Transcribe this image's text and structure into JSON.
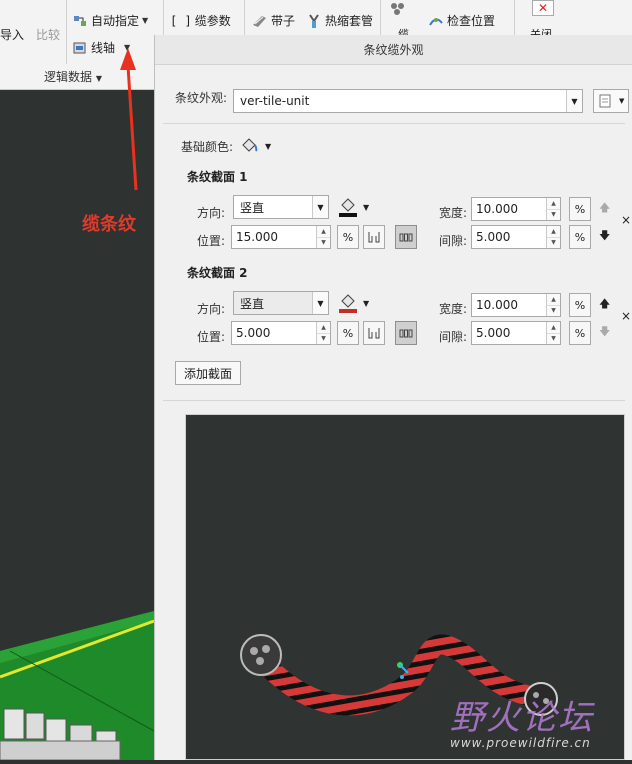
{
  "ribbon": {
    "import_label": "导入",
    "compare_label": "比较",
    "auto_assign_label": "自动指定",
    "cable_params_label": "缆参数",
    "tape_label": "带子",
    "heat_shrink_label": "热缩套管",
    "cable_label": "缆",
    "check_position_label": "检查位置",
    "close_label": "关闭",
    "spool_label": "线轴",
    "logic_data_label": "逻辑数据"
  },
  "annotation": {
    "text": "缆条纹"
  },
  "dialog": {
    "title": "条纹缆外观",
    "appearance_label": "条纹外观:",
    "appearance_value": "ver-tile-unit",
    "base_color_label": "基础颜色:",
    "sections": [
      {
        "title": "条纹截面 1",
        "direction_label": "方向:",
        "direction_value": "竖直",
        "position_label": "位置:",
        "position_value": "15.000",
        "width_label": "宽度:",
        "width_value": "10.000",
        "gap_label": "间隙:",
        "gap_value": "5.000",
        "percent": "%"
      },
      {
        "title": "条纹截面 2",
        "direction_label": "方向:",
        "direction_value": "竖直",
        "position_label": "位置:",
        "position_value": "5.000",
        "width_label": "宽度:",
        "width_value": "10.000",
        "gap_label": "间隙:",
        "gap_value": "5.000",
        "percent": "%"
      }
    ],
    "add_section_label": "添加截面",
    "close_x": "×"
  },
  "colors": {
    "section1_color": "#111111",
    "section2_color": "#c0302a",
    "cable_stripe": "#d63a38"
  },
  "watermark": {
    "title": "野火论坛",
    "url": "www.proewildfire.cn"
  }
}
